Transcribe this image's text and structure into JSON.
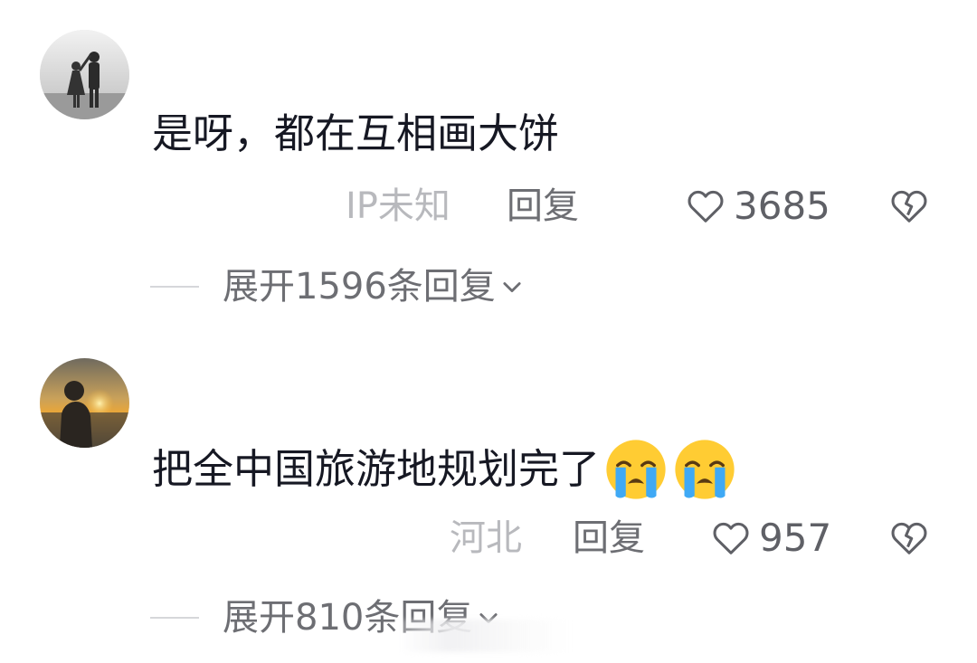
{
  "comments": [
    {
      "avatar_icon": "couple-silhouette-avatar",
      "text": "是呀，都在互相画大饼",
      "ip": "IP未知",
      "reply_label": "回复",
      "likes": "3685",
      "expand_label": "展开1596条回复"
    },
    {
      "avatar_icon": "sunset-silhouette-avatar",
      "text": "把全中国旅游地规划完了",
      "emojis": [
        "loudly-crying-face-emoji",
        "loudly-crying-face-emoji"
      ],
      "ip": "河北",
      "reply_label": "回复",
      "likes": "957",
      "expand_label": "展开810条回复"
    }
  ],
  "colors": {
    "text_primary": "#161823",
    "text_secondary": "#6d6e73",
    "text_muted": "#b8b9bd"
  }
}
